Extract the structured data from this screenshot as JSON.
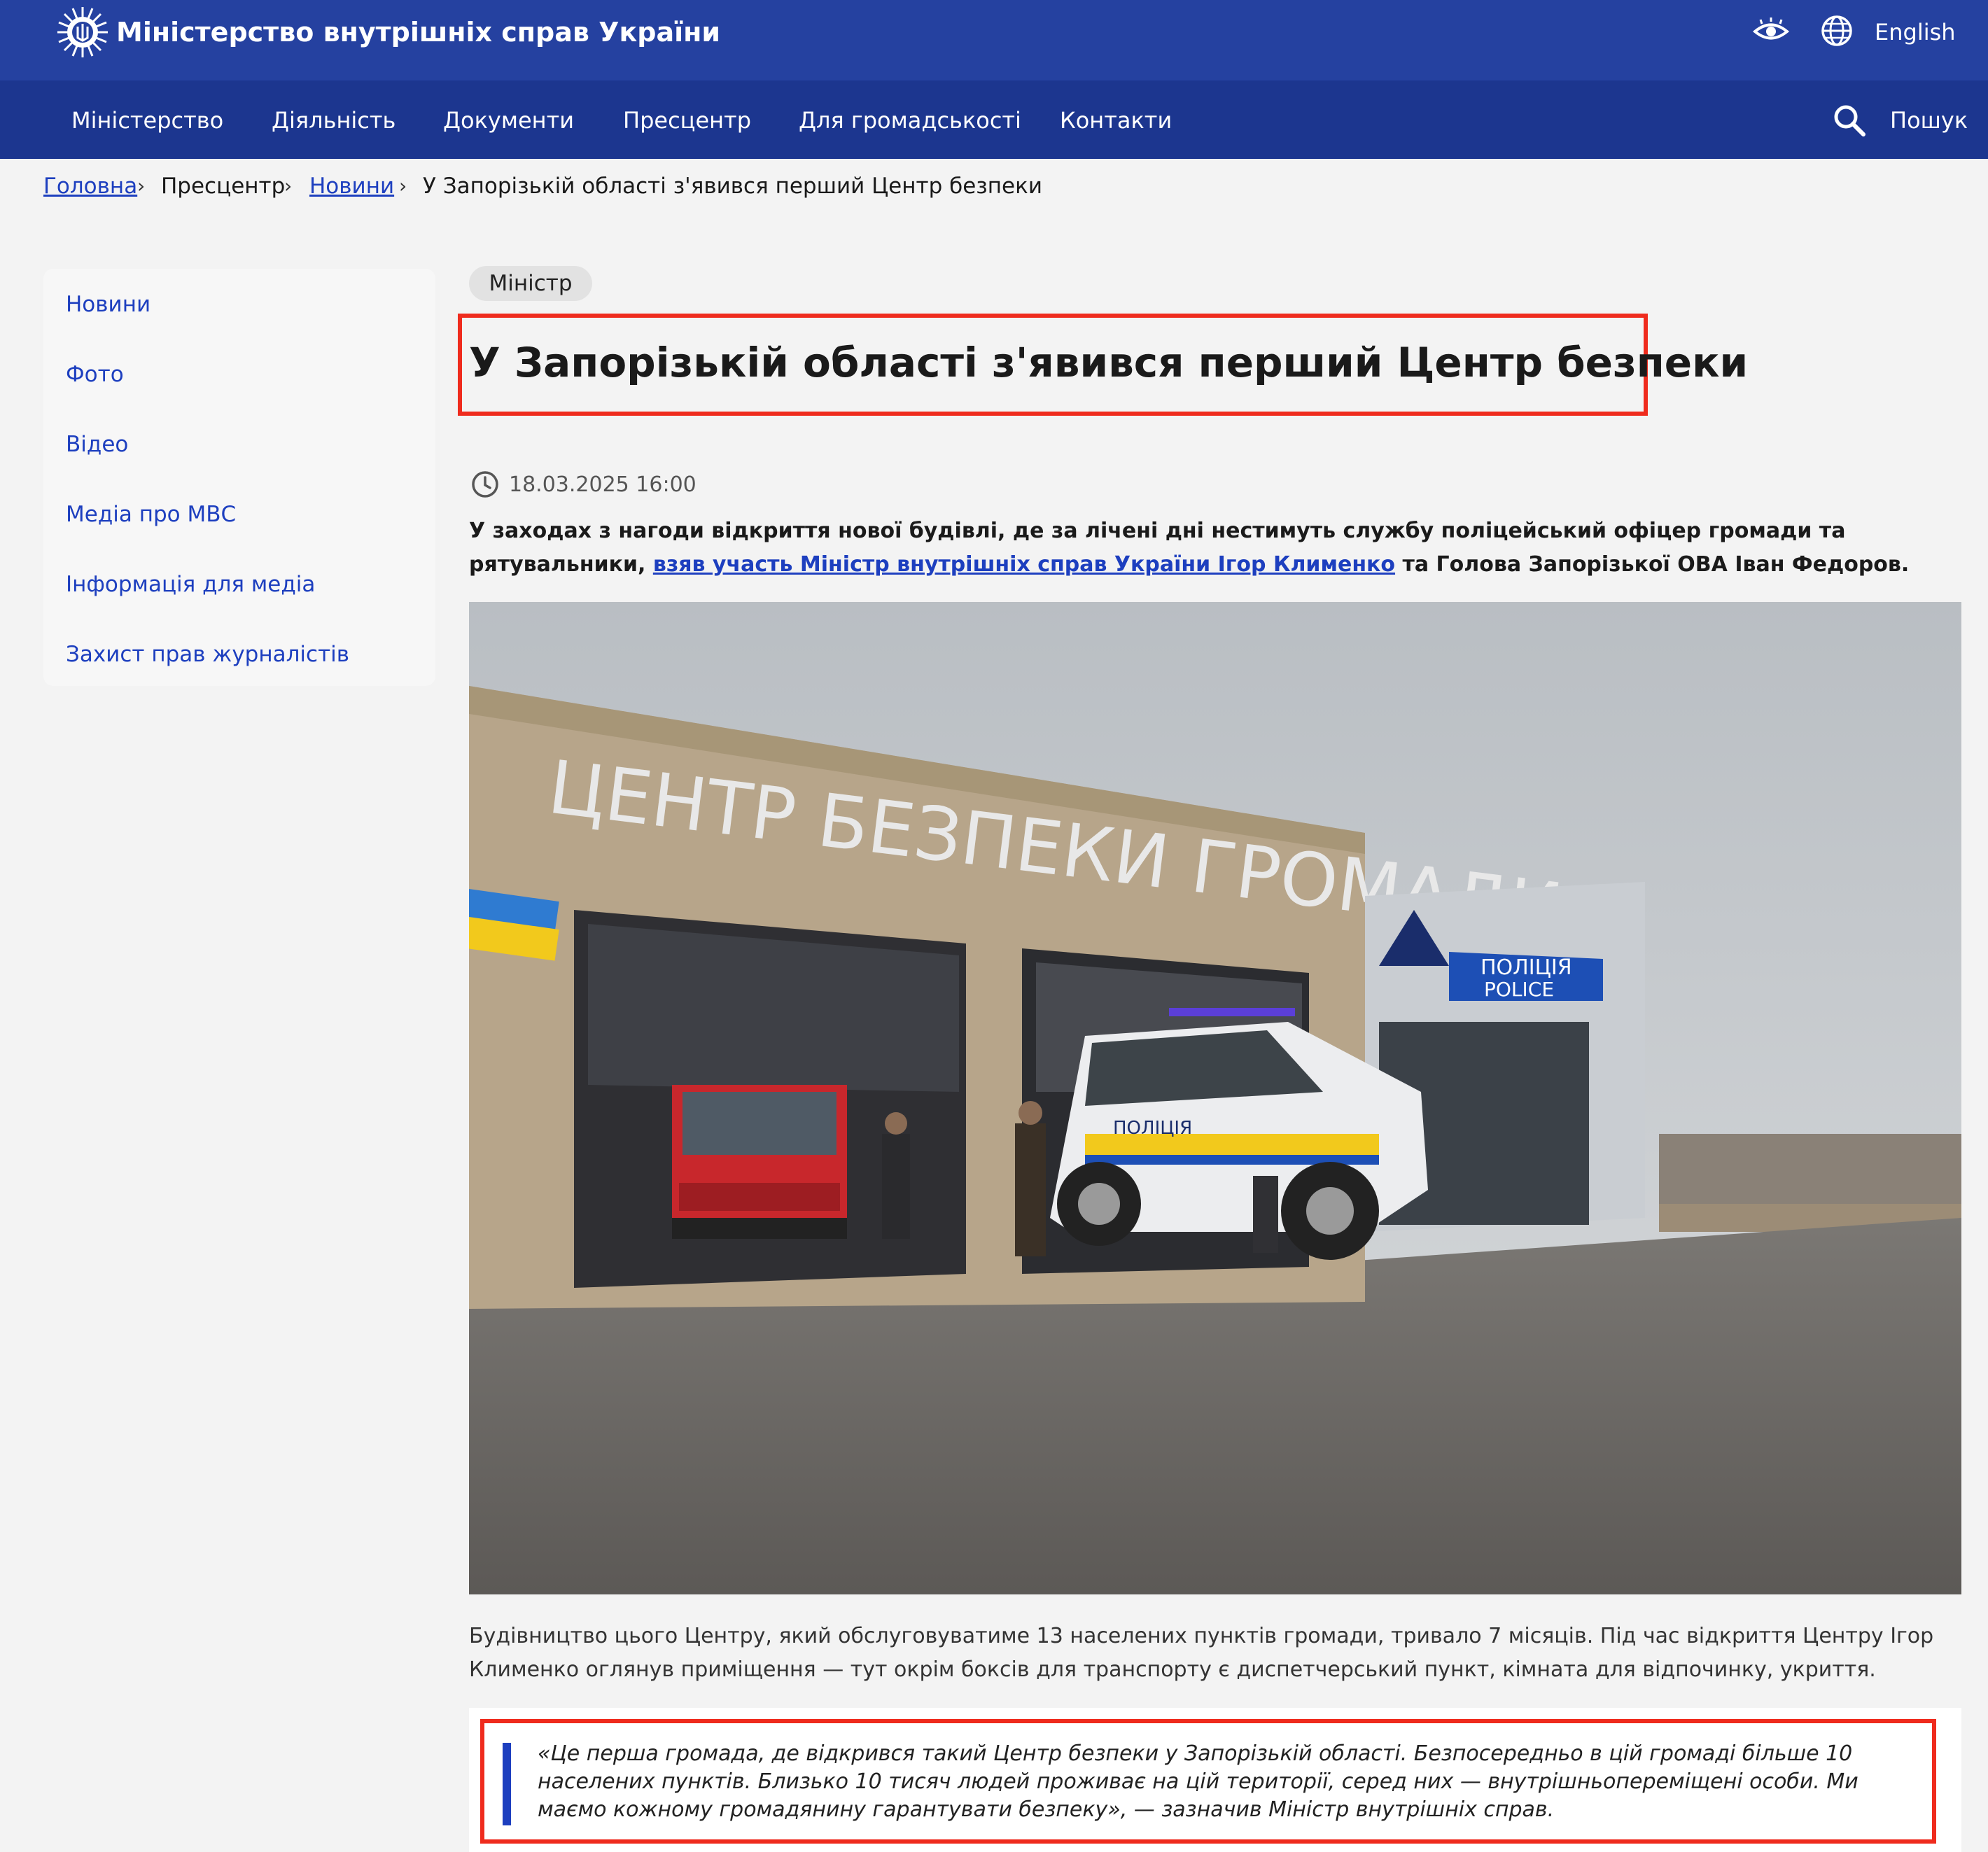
{
  "header": {
    "site_title": "Міністерство внутрішніх справ України",
    "language_link": "English",
    "icons": [
      "ministry-emblem",
      "accessibility-eye-icon",
      "globe-icon"
    ]
  },
  "nav": {
    "items": [
      "Міністерство",
      "Діяльність",
      "Документи",
      "Пресцентр",
      "Для громадськості",
      "Контакти"
    ],
    "search_label": "Пошук"
  },
  "breadcrumb": {
    "home": "Головна",
    "press": "Пресцентр",
    "news": "Новини",
    "current": "У Запорізькій області з'явився перший Центр безпеки",
    "separator": "›"
  },
  "sidebar": {
    "items": [
      "Новини",
      "Фото",
      "Відео",
      "Медіа про МВС",
      "Інформація для медіа",
      "Захист прав журналістів"
    ]
  },
  "article": {
    "tag": "Міністр",
    "title": "У Запорізькій області з'явився перший Центр безпеки",
    "datetime": "18.03.2025 16:00",
    "lead_part1": "У заходах з нагоди відкриття нової будівлі, де за лічені дні нестимуть службу поліцейський офіцер громади та рятувальники, ",
    "lead_link": "взяв участь Міністр внутрішніх справ України Ігор Клименко",
    "lead_part2": " та Голова Запорізької ОВА Іван Федоров.",
    "photo": {
      "building_sign": "ЦЕНТР БЕЗПЕКИ ГРОМАДИ",
      "police_sign_ua": "ПОЛІЦІЯ",
      "police_sign_en": "POLICE",
      "car_text": "ПОЛІЦІЯ"
    },
    "paragraph": "Будівництво цього Центру, який обслуговуватиме 13 населених пунктів громади, тривало 7 місяців. Під час відкриття Центру Ігор Клименко оглянув приміщення — тут окрім боксів для транспорту є диспетчерський пункт, кімната для відпочинку, укриття.",
    "quote": "«Це перша громада, де відкрився такий Центр безпеки у Запорізькій області. Безпосередньо в цій громаді більше 10 населених пунктів. Близько 10 тисяч людей проживає на цій території, серед них — внутрішньопереміщені особи. Ми маємо кожному громадянину гарантувати безпеку», — зазначив Міністр внутрішніх справ."
  },
  "colors": {
    "topbar": "#2541a0",
    "navbar": "#1c368f",
    "link": "#1d3fbf",
    "highlight": "#ef2b1d"
  }
}
